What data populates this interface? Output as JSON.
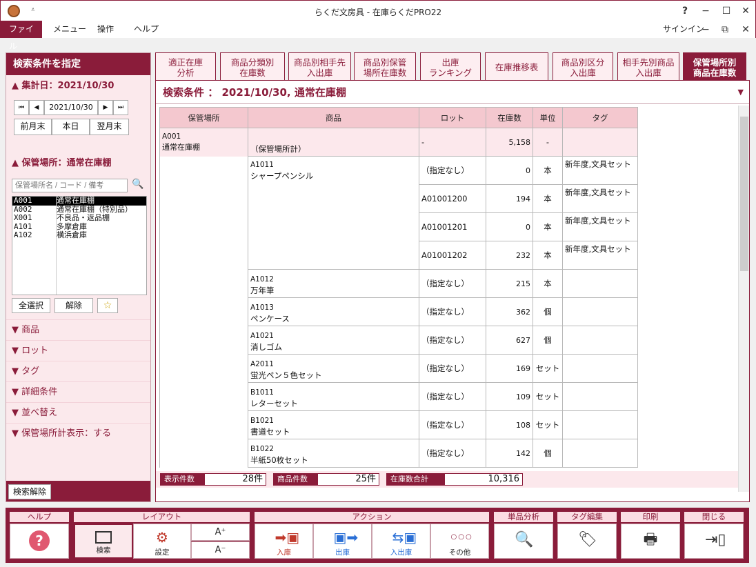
{
  "window": {
    "title": "らくだ文房具 - 在庫らくだPRO22",
    "qa": "⩡",
    "help": "?",
    "min": "−",
    "max": "☐",
    "close": "✕",
    "signin": "サインイン",
    "sub_min": "−",
    "sub_restore": "⧉",
    "sub_close": "✕"
  },
  "menu": [
    "ファイル",
    "メニュー",
    "操作",
    "ヘルプ"
  ],
  "sidebar": {
    "header": "検索条件を指定",
    "date_title": "▲ 集計日：2021/10/30",
    "date_value": "2021/10/30",
    "nav_first": "⏮",
    "nav_prev": "◀",
    "nav_next": "▶",
    "nav_last": "⏭",
    "btn_prev_month": "前月末",
    "btn_today": "本日",
    "btn_next_month": "翌月末",
    "loc_title": "▲ 保管場所：通常在庫棚",
    "loc_placeholder": "保管場所名 / コード / 備考",
    "search_icon": "🔍",
    "locations": [
      {
        "code": "A001",
        "name": "通常在庫棚"
      },
      {
        "code": "A002",
        "name": "通常在庫棚（特別品）"
      },
      {
        "code": "X001",
        "name": "不良品・返品棚"
      },
      {
        "code": "A101",
        "name": "多摩倉庫"
      },
      {
        "code": "A102",
        "name": "横浜倉庫"
      }
    ],
    "btn_select_all": "全選択",
    "btn_clear": "解除",
    "star_icon": "☆",
    "sections": [
      "▼ 商品",
      "▼ ロット",
      "▼ タグ",
      "▼ 詳細条件",
      "▼ 並べ替え",
      "▼ 保管場所計表示：する"
    ],
    "btn_search_clear": "検索解除"
  },
  "tabs": [
    "適正在庫\n分析",
    "商品分類別\n在庫数",
    "商品別相手先\n入出庫",
    "商品別保管\n場所在庫数",
    "出庫\nランキング",
    "在庫推移表",
    "商品別区分\n入出庫",
    "相手先別商品\n入出庫",
    "保管場所別\n商品在庫数"
  ],
  "condition": {
    "text": "検索条件 ： 2021/10/30, 通常在庫棚",
    "arrow": "▼"
  },
  "table": {
    "headers": [
      "保管場所",
      "商品",
      "ロット",
      "在庫数",
      "単位",
      "タグ"
    ],
    "location_code": "A001",
    "location_name": "通常在庫棚",
    "rows": [
      {
        "code": "",
        "name": "（保管場所計）",
        "lot": "-",
        "qty": "5,158",
        "unit": "-",
        "tag": ""
      },
      {
        "code": "A1011",
        "name": "シャープペンシル",
        "lot": "（指定なし）",
        "qty": "0",
        "unit": "本",
        "tag": "新年度,文具セット"
      },
      {
        "code": "",
        "name": "",
        "lot": "A01001200",
        "qty": "194",
        "unit": "本",
        "tag": "新年度,文具セット"
      },
      {
        "code": "",
        "name": "",
        "lot": "A01001201",
        "qty": "0",
        "unit": "本",
        "tag": "新年度,文具セット"
      },
      {
        "code": "",
        "name": "",
        "lot": "A01001202",
        "qty": "232",
        "unit": "本",
        "tag": "新年度,文具セット"
      },
      {
        "code": "A1012",
        "name": "万年筆",
        "lot": "（指定なし）",
        "qty": "215",
        "unit": "本",
        "tag": ""
      },
      {
        "code": "A1013",
        "name": "ペンケース",
        "lot": "（指定なし）",
        "qty": "362",
        "unit": "個",
        "tag": ""
      },
      {
        "code": "A1021",
        "name": "消しゴム",
        "lot": "（指定なし）",
        "qty": "627",
        "unit": "個",
        "tag": ""
      },
      {
        "code": "A2011",
        "name": "蛍光ペン５色セット",
        "lot": "（指定なし）",
        "qty": "169",
        "unit": "セット",
        "tag": ""
      },
      {
        "code": "B1011",
        "name": "レターセット",
        "lot": "（指定なし）",
        "qty": "109",
        "unit": "セット",
        "tag": ""
      },
      {
        "code": "B1021",
        "name": "書道セット",
        "lot": "（指定なし）",
        "qty": "108",
        "unit": "セット",
        "tag": ""
      },
      {
        "code": "B1022",
        "name": "半紙50枚セット",
        "lot": "（指定なし）",
        "qty": "142",
        "unit": "個",
        "tag": ""
      }
    ]
  },
  "status": {
    "display_label": "表示件数",
    "display_value": "28件",
    "product_label": "商品件数",
    "product_value": "25件",
    "total_label": "在庫数合計",
    "total_value": "10,316"
  },
  "bottom": {
    "help_group": "ヘルプ",
    "help_icon": "?",
    "layout_group": "レイアウト",
    "search_label": "検索",
    "settings_label": "設定",
    "font_up": "A⁺",
    "font_down": "A⁻",
    "action_group": "アクション",
    "in_label": "入庫",
    "out_label": "出庫",
    "inout_label": "入出庫",
    "other_label": "その他",
    "other_icon": "○○○",
    "analysis_group": "単品分析",
    "tag_group": "タグ編集",
    "print_group": "印刷",
    "close_group": "閉じる"
  }
}
